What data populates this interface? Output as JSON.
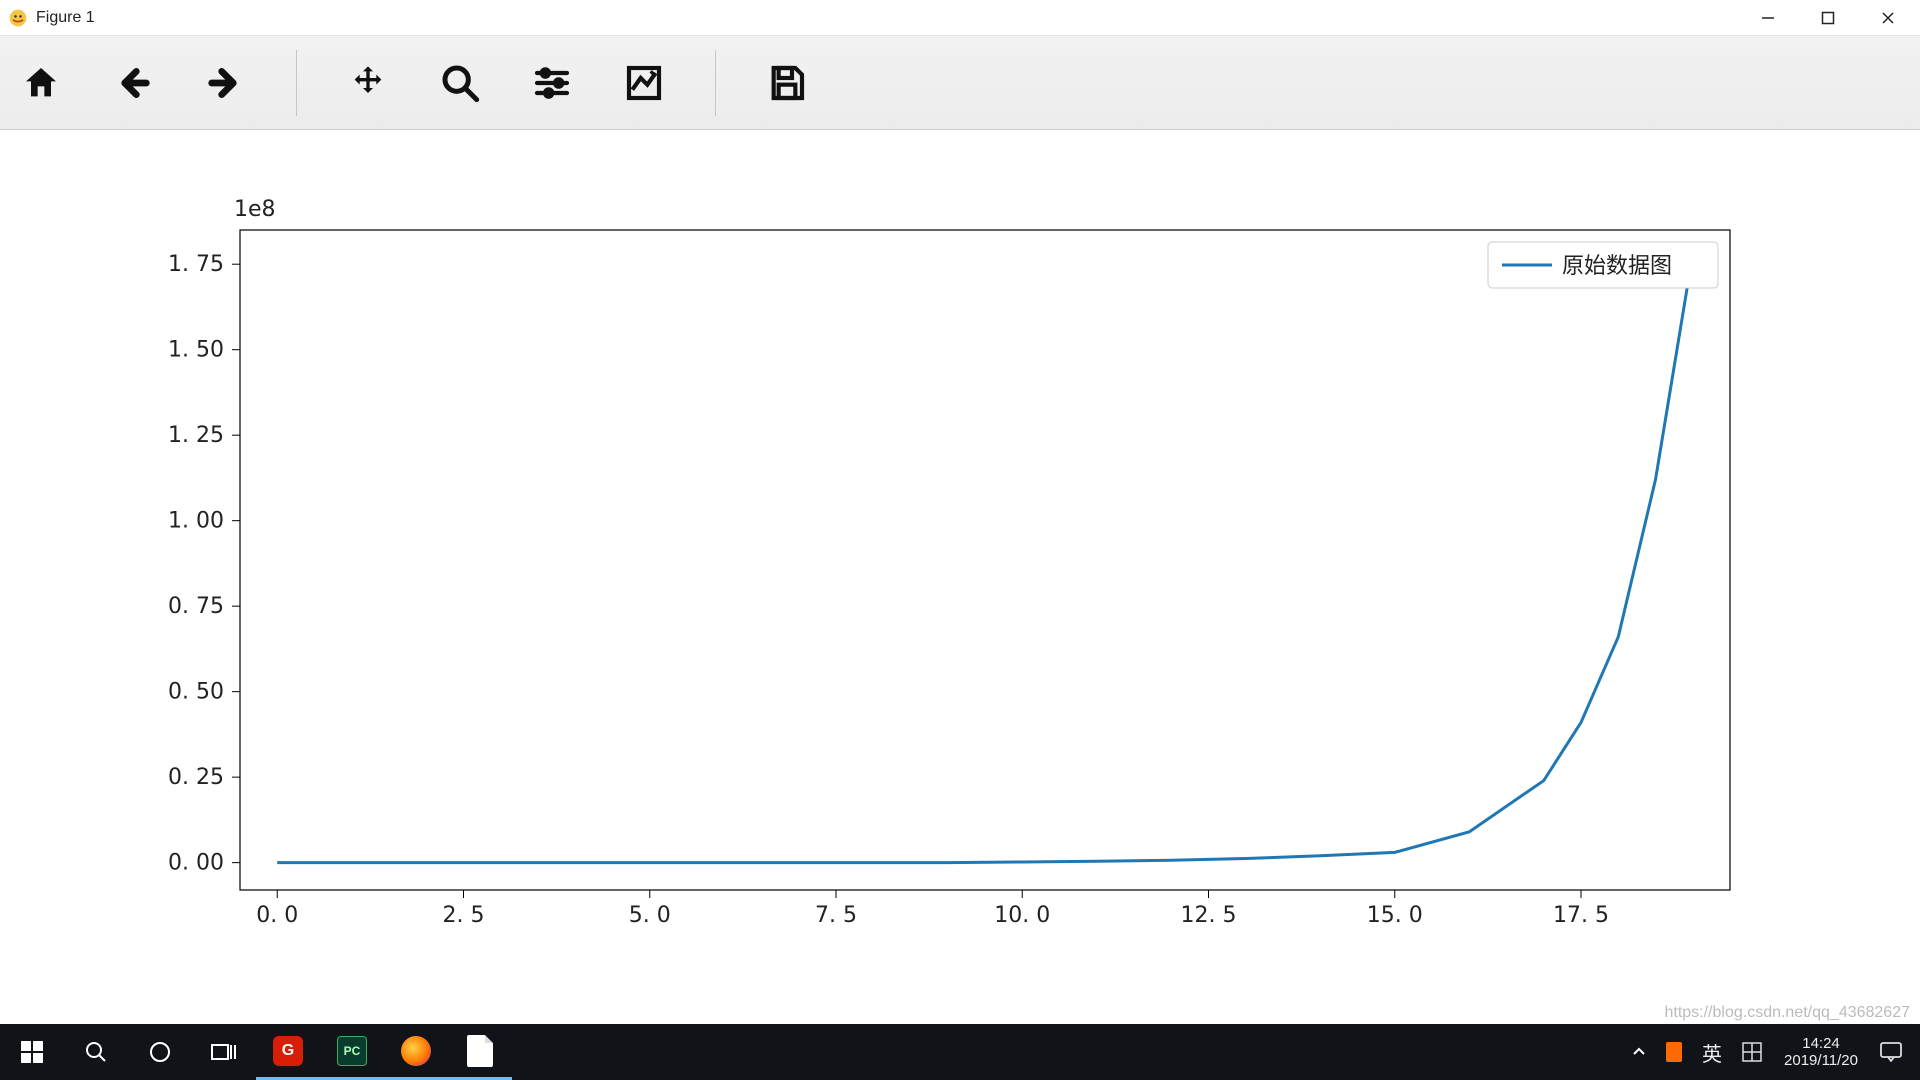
{
  "window": {
    "title": "Figure 1"
  },
  "toolbar": {
    "home": "Home",
    "back": "Back",
    "forward": "Forward",
    "pan": "Pan",
    "zoom": "Zoom",
    "subplots": "Configure subplots",
    "edit": "Edit axis",
    "save": "Save"
  },
  "chart_data": {
    "type": "line",
    "offset_text": "1e8",
    "x": [
      0,
      1,
      2,
      3,
      4,
      5,
      6,
      7,
      8,
      9,
      10,
      11,
      12,
      13,
      14,
      15,
      16,
      17,
      17.5,
      18,
      18.5,
      19
    ],
    "values_e8": [
      0,
      0,
      0,
      0,
      0,
      0,
      0,
      0,
      0,
      0,
      0.002,
      0.004,
      0.007,
      0.012,
      0.02,
      0.03,
      0.09,
      0.24,
      0.41,
      0.66,
      1.12,
      1.78
    ],
    "xticks": [
      0.0,
      2.5,
      5.0,
      7.5,
      10.0,
      12.5,
      15.0,
      17.5
    ],
    "xtick_labels": [
      "0. 0",
      "2. 5",
      "5. 0",
      "7. 5",
      "10. 0",
      "12. 5",
      "15. 0",
      "17. 5"
    ],
    "yticks": [
      0.0,
      0.25,
      0.5,
      0.75,
      1.0,
      1.25,
      1.5,
      1.75
    ],
    "ytick_labels": [
      "0. 00",
      "0. 25",
      "0. 50",
      "0. 75",
      "1. 00",
      "1. 25",
      "1. 50",
      "1. 75"
    ],
    "xlim": [
      -0.5,
      19.5
    ],
    "ylim": [
      -0.08,
      1.85
    ],
    "legend": [
      "原始数据图"
    ],
    "line_color": "#1f77b4"
  },
  "taskbar": {
    "ime": "英",
    "clock_time": "14:24",
    "clock_date": "2019/11/20"
  },
  "watermark": "https://blog.csdn.net/qq_43682627"
}
